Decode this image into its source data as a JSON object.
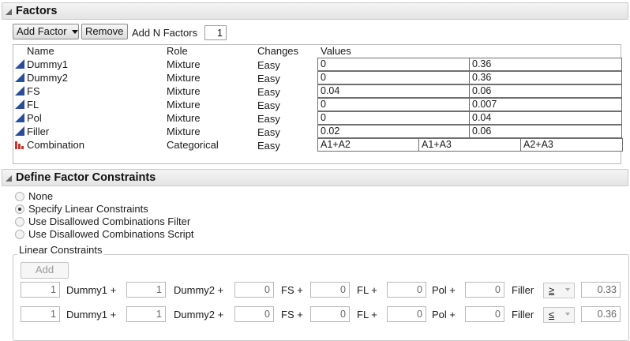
{
  "factors": {
    "title": "Factors",
    "add_factor_label": "Add Factor",
    "remove_label": "Remove",
    "add_n_label": "Add N Factors",
    "add_n_value": "1",
    "columns": [
      "Name",
      "Role",
      "Changes",
      "Values"
    ],
    "rows": [
      {
        "name": "Dummy1",
        "role": "Mixture",
        "changes": "Easy",
        "values": [
          "0",
          "0.36"
        ],
        "icon": "continuous-factor-icon"
      },
      {
        "name": "Dummy2",
        "role": "Mixture",
        "changes": "Easy",
        "values": [
          "0",
          "0.36"
        ],
        "icon": "continuous-factor-icon"
      },
      {
        "name": "FS",
        "role": "Mixture",
        "changes": "Easy",
        "values": [
          "0.04",
          "0.06"
        ],
        "icon": "continuous-factor-icon"
      },
      {
        "name": "FL",
        "role": "Mixture",
        "changes": "Easy",
        "values": [
          "0",
          "0.007"
        ],
        "icon": "continuous-factor-icon"
      },
      {
        "name": "Pol",
        "role": "Mixture",
        "changes": "Easy",
        "values": [
          "0",
          "0.04"
        ],
        "icon": "continuous-factor-icon"
      },
      {
        "name": "Filler",
        "role": "Mixture",
        "changes": "Easy",
        "values": [
          "0.02",
          "0.06"
        ],
        "icon": "continuous-factor-icon"
      },
      {
        "name": "Combination",
        "role": "Categorical",
        "changes": "Easy",
        "values": [
          "A1+A2",
          "A1+A3",
          "A2+A3"
        ],
        "icon": "categorical-factor-icon"
      }
    ]
  },
  "constraints": {
    "title": "Define Factor Constraints",
    "options": [
      {
        "label": "None",
        "selected": false
      },
      {
        "label": "Specify Linear Constraints",
        "selected": true
      },
      {
        "label": "Use Disallowed Combinations Filter",
        "selected": false
      },
      {
        "label": "Use Disallowed Combinations Script",
        "selected": false
      }
    ],
    "linear": {
      "title": "Linear Constraints",
      "add_label": "Add",
      "rows": [
        {
          "terms": [
            {
              "coef": "1",
              "name": "Dummy1 +"
            },
            {
              "coef": "1",
              "name": "Dummy2 +"
            },
            {
              "coef": "0",
              "name": "FS +"
            },
            {
              "coef": "0",
              "name": "FL +"
            },
            {
              "coef": "0",
              "name": "Pol +"
            },
            {
              "coef": "0",
              "name": "Filler"
            }
          ],
          "inequality": "≥",
          "rhs": "0.33"
        },
        {
          "terms": [
            {
              "coef": "1",
              "name": "Dummy1 +"
            },
            {
              "coef": "1",
              "name": "Dummy2 +"
            },
            {
              "coef": "0",
              "name": "FS +"
            },
            {
              "coef": "0",
              "name": "FL +"
            },
            {
              "coef": "0",
              "name": "Pol +"
            },
            {
              "coef": "0",
              "name": "Filler"
            }
          ],
          "inequality": "≤",
          "rhs": "0.36"
        }
      ]
    }
  },
  "colors": {
    "continuous_icon": "#2a4d9a",
    "categorical_icon": "#c0392b"
  }
}
